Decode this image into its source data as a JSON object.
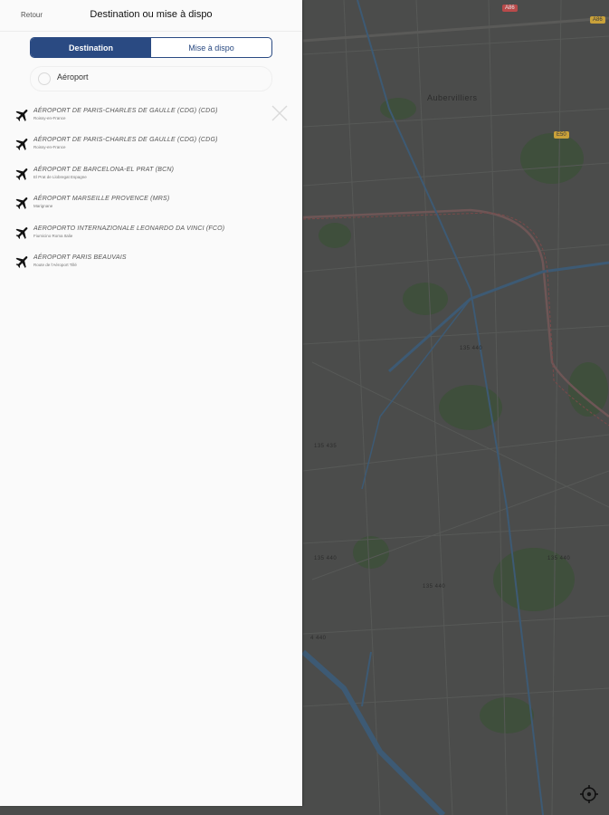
{
  "header": {
    "back_label": "Retour",
    "title": "Destination ou mise à dispo"
  },
  "segments": {
    "destination": "Destination",
    "mise_a_dispo": "Mise à dispo"
  },
  "search": {
    "value": "Aéroport",
    "icon": "search-icon"
  },
  "results": [
    {
      "name": "AÉROPORT DE PARIS-CHARLES DE GAULLE (CDG) (CDG)",
      "sub": "Roissy-en-France",
      "icon": "airplane-icon"
    },
    {
      "name": "AÉROPORT DE PARIS-CHARLES DE GAULLE (CDG) (CDG)",
      "sub": "Roissy-en-France",
      "icon": "airplane-icon"
    },
    {
      "name": "AÉROPORT DE BARCELONA-EL PRAT (BCN)",
      "sub": "El Prat de Llobregat Espagne",
      "icon": "airplane-icon"
    },
    {
      "name": "AÉROPORT MARSEILLE PROVENCE (MRS)",
      "sub": "Marignane",
      "icon": "airplane-icon"
    },
    {
      "name": "AEROPORTO INTERNAZIONALE LEONARDO DA VINCI (FCO)",
      "sub": "Fiumicino Roma Italie",
      "icon": "airplane-icon"
    },
    {
      "name": "AÉROPORT PARIS BEAUVAIS",
      "sub": "Route de l'Aéroport Tillé",
      "icon": "airplane-icon"
    }
  ],
  "map": {
    "labels": [
      "Aubervilliers",
      "135 440",
      "135 435",
      "135 440",
      "135 440",
      "135 440",
      "4 440"
    ],
    "badges": [
      "A86",
      "E50",
      "A86"
    ]
  },
  "colors": {
    "accent": "#2a4a82",
    "panel_bg": "#fafafa",
    "map_overlay": "#4a4a4a"
  }
}
